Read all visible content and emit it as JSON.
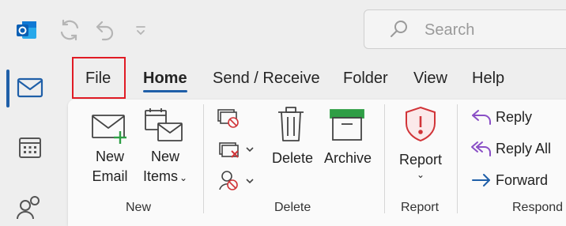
{
  "titlebar": {
    "app_icon": "outlook-logo-icon",
    "sync_icon": "sync-icon",
    "undo_icon": "undo-icon",
    "qat_icon": "quick-access-customize-icon",
    "search_placeholder": "Search"
  },
  "rail": {
    "items": [
      {
        "icon": "mail-icon",
        "selected": true
      },
      {
        "icon": "calendar-icon",
        "selected": false
      },
      {
        "icon": "people-icon",
        "selected": false
      }
    ]
  },
  "tabs": [
    {
      "label": "File",
      "highlighted": true
    },
    {
      "label": "Home",
      "active": true
    },
    {
      "label": "Send / Receive"
    },
    {
      "label": "Folder"
    },
    {
      "label": "View"
    },
    {
      "label": "Help"
    }
  ],
  "ribbon": {
    "new_group": {
      "label": "New",
      "new_email": {
        "line1": "New",
        "line2": "Email"
      },
      "new_items": {
        "line1": "New",
        "line2": "Items"
      }
    },
    "delete_group": {
      "label": "Delete",
      "delete": "Delete",
      "archive": "Archive"
    },
    "report_group": {
      "label": "Report",
      "report": "Report"
    },
    "respond_group": {
      "label": "Respond",
      "reply": "Reply",
      "reply_all": "Reply All",
      "forward": "Forward"
    }
  },
  "colors": {
    "accent": "#1f5fa8",
    "highlight_box": "#e01b24",
    "new_plus": "#2e9e45",
    "archive_green": "#2e9e45",
    "report_red": "#d13438",
    "reply_purple": "#8a4fc6",
    "forward_blue": "#1f5fa8"
  }
}
